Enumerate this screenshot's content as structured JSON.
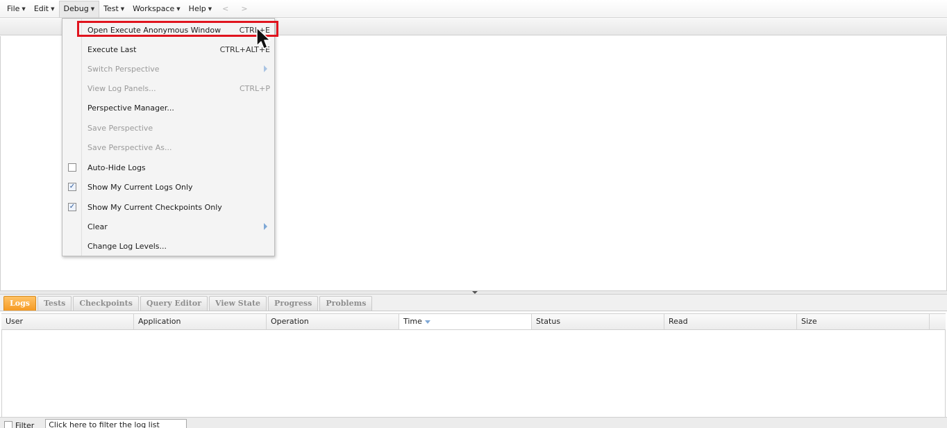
{
  "menubar": {
    "items": [
      {
        "label": "File"
      },
      {
        "label": "Edit"
      },
      {
        "label": "Debug"
      },
      {
        "label": "Test"
      },
      {
        "label": "Workspace"
      },
      {
        "label": "Help"
      }
    ],
    "back": "<",
    "forward": ">"
  },
  "debug_menu": {
    "items": [
      {
        "label": "Open Execute Anonymous Window",
        "shortcut": "CTRL+E",
        "highlighted": true
      },
      {
        "label": "Execute Last",
        "shortcut": "CTRL+ALT+E"
      },
      {
        "label": "Switch Perspective",
        "disabled": true,
        "submenu": true
      },
      {
        "label": "View Log Panels...",
        "shortcut": "CTRL+P",
        "disabled": true
      },
      {
        "label": "Perspective Manager..."
      },
      {
        "label": "Save Perspective",
        "disabled": true
      },
      {
        "label": "Save Perspective As...",
        "disabled": true
      },
      {
        "label": "Auto-Hide Logs",
        "checkbox": true,
        "checked": false
      },
      {
        "label": "Show My Current Logs Only",
        "checkbox": true,
        "checked": true
      },
      {
        "label": "Show My Current Checkpoints Only",
        "checkbox": true,
        "checked": true
      },
      {
        "label": "Clear",
        "submenu": true
      },
      {
        "label": "Change Log Levels..."
      }
    ]
  },
  "tabs": [
    {
      "label": "Logs",
      "active": true
    },
    {
      "label": "Tests"
    },
    {
      "label": "Checkpoints"
    },
    {
      "label": "Query Editor"
    },
    {
      "label": "View State"
    },
    {
      "label": "Progress"
    },
    {
      "label": "Problems"
    }
  ],
  "grid": {
    "columns": [
      "User",
      "Application",
      "Operation",
      "Time",
      "Status",
      "Read",
      "Size"
    ],
    "sorted_column": "Time"
  },
  "filter": {
    "label": "Filter",
    "placeholder": "Click here to filter the log list"
  },
  "colors": {
    "active_tab": "#f59a23",
    "highlight": "#e0141e",
    "accent_arrow": "#7fa8d6"
  }
}
